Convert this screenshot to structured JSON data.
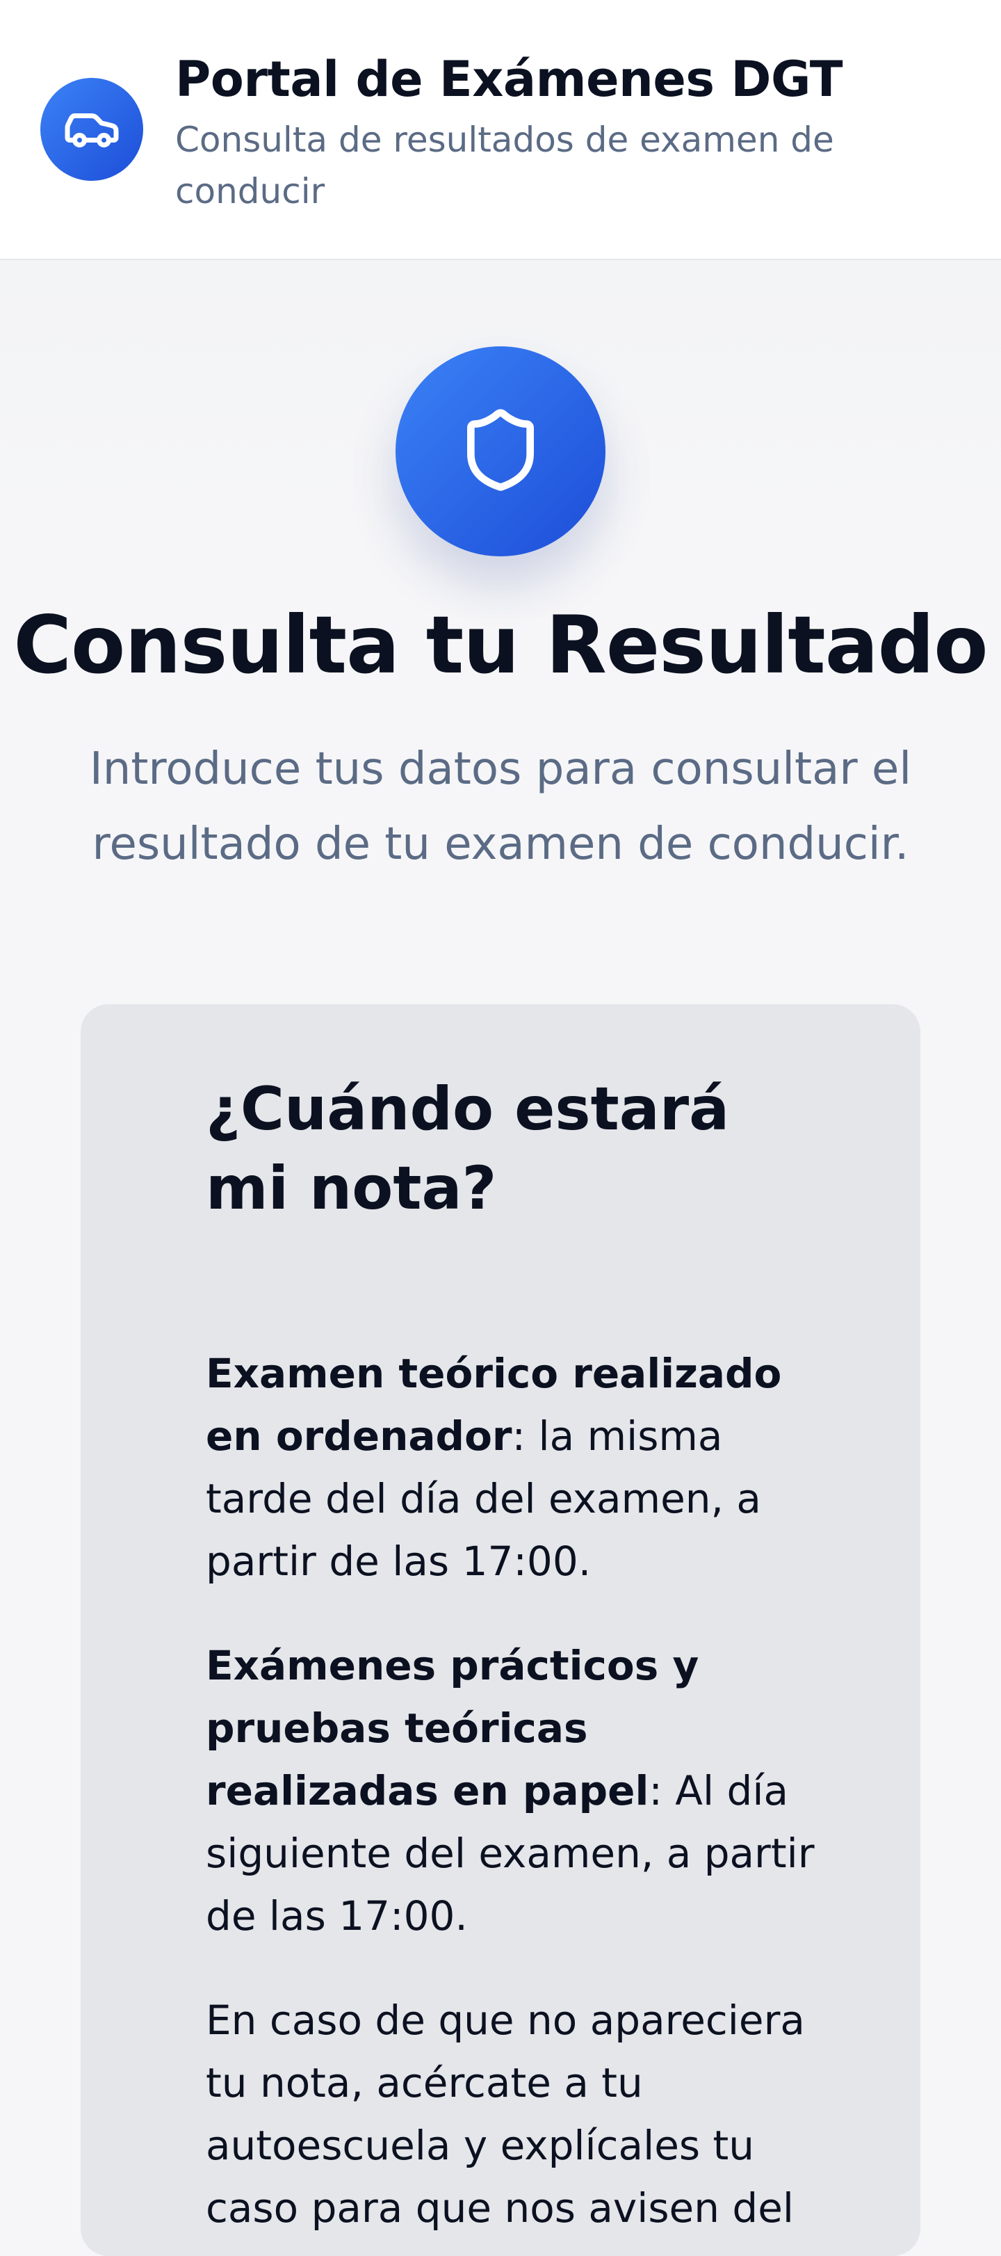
{
  "header": {
    "title": "Portal de Exámenes DGT",
    "subtitle": "Consulta de resultados de examen de conducir",
    "logo_icon": "car-icon"
  },
  "hero": {
    "icon": "shield-icon",
    "title": "Consulta tu Resultado",
    "intro": "Introduce tus datos para consultar el resultado de tu examen de conducir."
  },
  "info": {
    "title": "¿Cuándo estará mi nota?",
    "items": [
      {
        "bold": "Examen teórico realizado en ordenador",
        "text": ": la misma tarde del día del examen, a partir de las 17:00."
      },
      {
        "bold": "Exámenes prácticos y pruebas teóricas realizadas en papel",
        "text": ": Al día siguiente del examen, a partir de las 17:00."
      }
    ],
    "note": "En caso de que no apareciera tu nota, acércate a tu autoescuela y explícales tu caso para que nos avisen del"
  },
  "colors": {
    "accent": "#2563eb",
    "accent_light": "#3b82f6",
    "text_dark": "#0b1120",
    "text_muted": "#5b6b85",
    "page_bg": "#f6f6f8",
    "card_bg": "#e5e6ea"
  }
}
